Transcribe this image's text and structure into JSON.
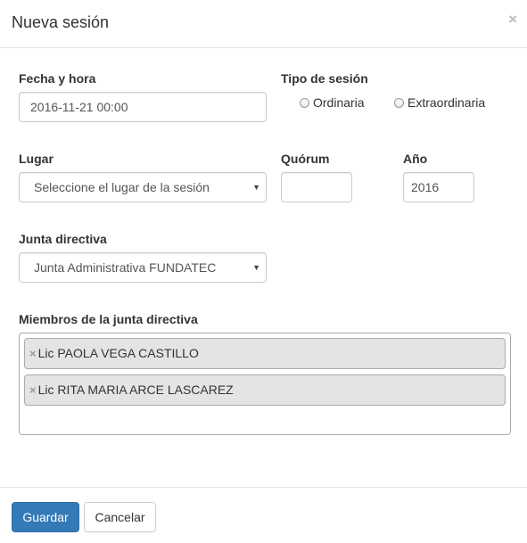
{
  "modal": {
    "title": "Nueva sesión",
    "close_icon": "×"
  },
  "form": {
    "fecha": {
      "label": "Fecha y hora",
      "value": "2016-11-21 00:00"
    },
    "tipo": {
      "label": "Tipo de sesión",
      "options": [
        "Ordinaria",
        "Extraordinaria"
      ]
    },
    "lugar": {
      "label": "Lugar",
      "selected": "Seleccione el lugar de la sesión"
    },
    "quorum": {
      "label": "Quórum",
      "value": ""
    },
    "anio": {
      "label": "Año",
      "value": "2016"
    },
    "junta": {
      "label": "Junta directiva",
      "selected": "Junta Administrativa FUNDATEC"
    },
    "miembros": {
      "label": "Miembros de la junta directiva",
      "items": [
        "Lic PAOLA VEGA CASTILLO",
        "Lic RITA MARIA ARCE LASCAREZ"
      ],
      "remove_icon": "×"
    }
  },
  "footer": {
    "save_label": "Guardar",
    "cancel_label": "Cancelar"
  },
  "icons": {
    "caret": "▼"
  },
  "colors": {
    "primary": "#337ab7"
  }
}
